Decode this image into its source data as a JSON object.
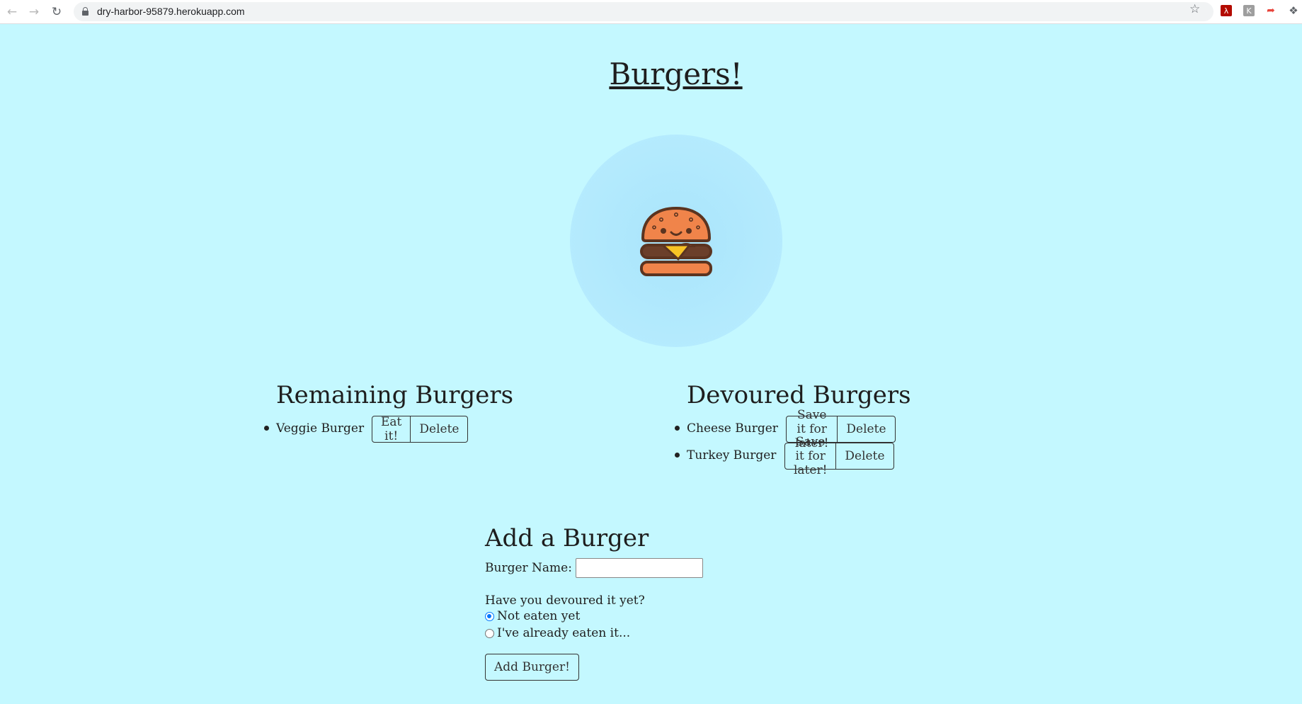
{
  "browser": {
    "url": "dry-harbor-95879.herokuapp.com",
    "icons": [
      "back-icon",
      "forward-icon",
      "reload-icon",
      "lock-icon",
      "bookmark-star-icon",
      "pdf-extension-icon",
      "extension-icon",
      "red-extension-icon",
      "puzzle-icon"
    ]
  },
  "page": {
    "title": "Burgers!",
    "logo_icon": "burger-icon"
  },
  "remaining": {
    "heading": "Remaining Burgers",
    "items": [
      {
        "name": "Veggie Burger",
        "eat_label": "Eat it!",
        "delete_label": "Delete"
      }
    ]
  },
  "devoured": {
    "heading": "Devoured Burgers",
    "items": [
      {
        "name": "Cheese Burger",
        "save_label": "Save it for later!",
        "delete_label": "Delete"
      },
      {
        "name": "Turkey Burger",
        "save_label": "Save it for later!",
        "delete_label": "Delete"
      }
    ]
  },
  "form": {
    "heading": "Add a Burger",
    "name_label": "Burger Name:",
    "name_value": "",
    "question": "Have you devoured it yet?",
    "options": [
      {
        "label": "Not eaten yet",
        "checked": true
      },
      {
        "label": "I've already eaten it...",
        "checked": false
      }
    ],
    "submit_label": "Add Burger!"
  },
  "colors": {
    "background": "#c4f8ff",
    "circle": "#b3eafd",
    "bun": "#f0844a",
    "patty": "#6b3f2a",
    "cheese": "#f7c325",
    "radio_accent": "#0075ff"
  }
}
